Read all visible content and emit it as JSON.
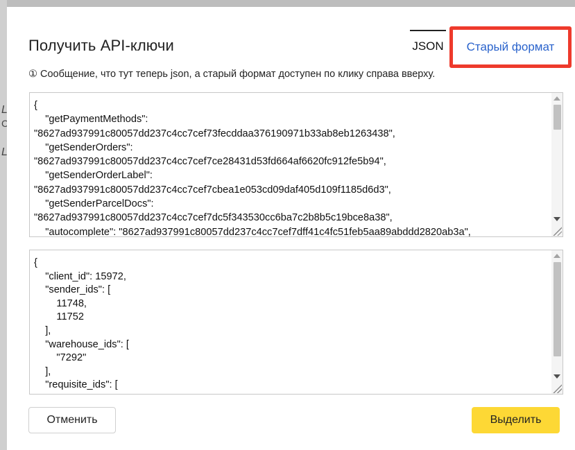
{
  "background": {
    "glyphs": [
      "L",
      "C",
      "L"
    ]
  },
  "dialog": {
    "title": "Получить API-ключи",
    "tabs": {
      "json_label": "JSON",
      "old_format_label": "Старый формат"
    },
    "notice": {
      "icon": "①",
      "text": "Сообщение, что тут теперь json, а старый формат доступен по клику справа вверху."
    },
    "api_keys_text": "{\n    \"getPaymentMethods\":\n\"8627ad937991c80057dd237c4cc7cef73fecddaa376190971b33ab8eb1263438\",\n    \"getSenderOrders\":\n\"8627ad937991c80057dd237c4cc7cef7ce28431d53fd664af6620fc912fe5b94\",\n    \"getSenderOrderLabel\":\n\"8627ad937991c80057dd237c4cc7cef7cbea1e053cd09daf405d109f1185d6d3\",\n    \"getSenderParcelDocs\":\n\"8627ad937991c80057dd237c4cc7cef7dc5f343530cc6ba7c2b8b5c19bce8a38\",\n    \"autocomplete\": \"8627ad937991c80057dd237c4cc7cef7dff41c4fc51feb5aa89abddd2820ab3a\",",
    "client_ids_text": "{\n    \"client_id\": 15972,\n    \"sender_ids\": [\n        11748,\n        11752\n    ],\n    \"warehouse_ids\": [\n        \"7292\"\n    ],\n    \"requisite_ids\": [",
    "buttons": {
      "cancel": "Отменить",
      "select": "Выделить"
    },
    "colors": {
      "accent_link": "#2a63cc",
      "highlight_border": "#ee3a2c",
      "primary_button": "#fdd835"
    }
  }
}
